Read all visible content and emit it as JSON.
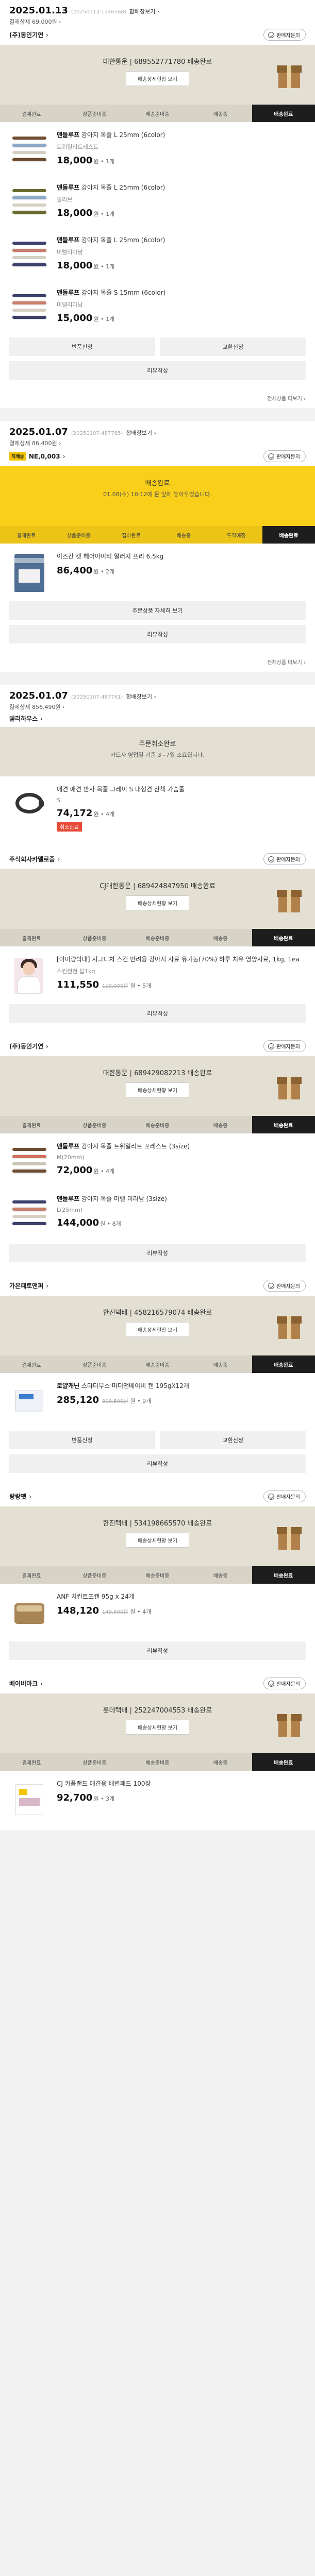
{
  "orders": [
    {
      "date": "2025.01.13",
      "order_no": "(20250113-1146568)",
      "detail_link": "합배장보기",
      "total": "결제상세 69,000원",
      "sub_orders": [
        {
          "seller": "(주)동인기연",
          "seller_badge": "",
          "inquiry_btn": "판매자문의",
          "status_title": "대한통운 | 689552771780 배송완료",
          "status_sub": "",
          "status_btn": "배송상세현황 보기",
          "box_icon": true,
          "steps": [
            "결제완료",
            "상품준비중",
            "배송준비중",
            "배송중",
            "배송완료"
          ],
          "active_step": 4,
          "items": [
            {
              "brand": "맨들루프",
              "title": "맨들루프 강아지 목줄 L 25mm (6color)",
              "option": "트위일리트레스트",
              "price": "18,000",
              "unit": "원 • 1개",
              "orig": "",
              "tag": "",
              "thumb": "collar1"
            },
            {
              "brand": "맨들루프",
              "title": "맨들루프 강아지 목줄 L 25mm (6color)",
              "option": "올리브",
              "price": "18,000",
              "unit": "원 • 1개",
              "orig": "",
              "tag": "",
              "thumb": "collar2"
            },
            {
              "brand": "맨들루프",
              "title": "맨들루프 강아지 목줄 L 25mm (6color)",
              "option": "미렐리아남",
              "price": "18,000",
              "unit": "원 • 1개",
              "orig": "",
              "tag": "",
              "thumb": "collar3"
            },
            {
              "brand": "맨들루프",
              "title": "맨들루프 강아지 목줄 S 15mm (6color)",
              "option": "미렐리아남",
              "price": "15,000",
              "unit": "원 • 1개",
              "orig": "",
              "tag": "",
              "thumb": "collar4"
            }
          ],
          "buttons_pair": [
            "반품신청",
            "교환신청"
          ],
          "button_full": "리뷰작성"
        }
      ],
      "more_link": "전체상품 더보기"
    },
    {
      "date": "2025.01.07",
      "order_no": "(20250107-487765)",
      "detail_link": "합배장보기",
      "total": "결제상세 86,400원",
      "sub_orders": [
        {
          "seller": "NE,0,003",
          "seller_badge": "직배송",
          "inquiry_btn": "판매자문의",
          "status_title": "배송완료",
          "status_sub": "01.08(수) 10:12에 문 앞에 놓아두었습니다.",
          "status_btn": "",
          "box_icon": false,
          "yellow": true,
          "steps": [
            "결제완료",
            "상품준비중",
            "집하완료",
            "배송중",
            "도착예정",
            "배송완료"
          ],
          "active_step": 5,
          "items": [
            {
              "brand": "",
              "title": "이즈칸 캣 헤어아이티 얼러지 프리 6.5kg",
              "option": "",
              "price": "86,400",
              "unit": "원 • 2개",
              "orig": "",
              "tag": "",
              "thumb": "bag"
            }
          ],
          "buttons_pair": [],
          "button_full": "주문상품 자세히 보기",
          "button_full2": "리뷰작성"
        }
      ],
      "more_link": "전체상품 더보기"
    },
    {
      "date": "2025.01.07",
      "order_no": "(20250107-487761)",
      "detail_link": "합배장보기",
      "total": "결제상세 856,490원",
      "sub_orders": [
        {
          "seller": "쉘리하우스",
          "seller_badge": "",
          "inquiry_btn": "",
          "status_title": "주문취소완료",
          "status_sub": "카드사 영업일 기준 3~7일 소요됩니다.",
          "status_btn": "",
          "box_icon": false,
          "steps": [],
          "active_step": -1,
          "items": [
            {
              "brand": "",
              "title": "애견 애견 반사 목줄 그레이 S 대형견 산책 가슴줄",
              "option": "S",
              "price": "74,172",
              "unit": "원 • 4개",
              "orig": "",
              "tag": "취소완료",
              "thumb": "band"
            }
          ],
          "buttons_pair": [],
          "button_full": ""
        },
        {
          "seller": "주식회사카멜로줌",
          "seller_badge": "",
          "inquiry_btn": "판매자문의",
          "status_title": "CJ대한통운 | 689424847950 배송완료",
          "status_sub": "",
          "status_btn": "배송상세현황 보기",
          "box_icon": true,
          "steps": [
            "결제완료",
            "상품준비중",
            "배송준비중",
            "배송중",
            "배송완료"
          ],
          "active_step": 4,
          "items": [
            {
              "brand": "",
              "title": "[이미량박대] 시그니처 스킨 반려용 강아지 사료 유기농(70%) 하루 치유 영양사료, 1kg, 1ea",
              "option": "스킨전천 탑1kg",
              "price": "111,550",
              "unit": "원 • 5개",
              "orig": "119,000원",
              "tag": "",
              "thumb": "person"
            }
          ],
          "buttons_pair": [],
          "button_full": "리뷰작성"
        },
        {
          "seller": "(주)동인기연",
          "seller_badge": "",
          "inquiry_btn": "판매자문의",
          "status_title": "대한통운 | 689429082213 배송완료",
          "status_sub": "",
          "status_btn": "배송상세현황 보기",
          "box_icon": true,
          "steps": [
            "결제완료",
            "상품준비중",
            "배송준비중",
            "배송중",
            "배송완료"
          ],
          "active_step": 4,
          "items": [
            {
              "brand": "맨들루프",
              "title": "맨들루프 강아지 목줄 트위일리트 포레스트 (3size)",
              "option": "M(20mm)",
              "price": "72,000",
              "unit": "원 • 4개",
              "orig": "",
              "tag": "",
              "thumb": "collar5"
            },
            {
              "brand": "맨들루프",
              "title": "맨들루프 강아지 목줄 미렐 미라남 (3size)",
              "option": "L(25mm)",
              "price": "144,000",
              "unit": "원 • 8개",
              "orig": "",
              "tag": "",
              "thumb": "collar6"
            }
          ],
          "buttons_pair": [],
          "button_full": "리뷰작성"
        },
        {
          "seller": "가온패토앤퍼",
          "seller_badge": "",
          "inquiry_btn": "판매자문의",
          "status_title": "한진택배 | 458216579074 배송완료",
          "status_sub": "",
          "status_btn": "배송상세현황 보기",
          "box_icon": true,
          "steps": [
            "결제완료",
            "상품준비중",
            "배송준비중",
            "배송중",
            "배송완료"
          ],
          "active_step": 4,
          "items": [
            {
              "brand": "로얄캐닌",
              "title": "로얄캐닌 스타터무스 마더앤베이비 캔 195gX12개",
              "option": "",
              "price": "285,120",
              "unit": "원 • 9개",
              "orig": "310,500원",
              "tag": "",
              "thumb": "cube"
            }
          ],
          "buttons_pair": [
            "반품신청",
            "교환신청"
          ],
          "button_full": "리뷰작성"
        },
        {
          "seller": "랑랑펫",
          "seller_badge": "",
          "inquiry_btn": "판매자문의",
          "status_title": "한진택배 | 534198665570 배송완료",
          "status_sub": "",
          "status_btn": "배송상세현황 보기",
          "box_icon": true,
          "steps": [
            "결제완료",
            "상품준비중",
            "배송준비중",
            "배송중",
            "배송완료"
          ],
          "active_step": 4,
          "items": [
            {
              "brand": "",
              "title": "ANF 치킨트프캔 95g x 24개",
              "option": "",
              "price": "148,120",
              "unit": "원 • 4개",
              "orig": "149,600원",
              "tag": "",
              "thumb": "can"
            }
          ],
          "buttons_pair": [],
          "button_full": "리뷰작성"
        },
        {
          "seller": "베이비마크",
          "seller_badge": "",
          "inquiry_btn": "판매자문의",
          "status_title": "롯데택배 | 252247004553 배송완료",
          "status_sub": "",
          "status_btn": "배송상세현황 보기",
          "box_icon": true,
          "steps": [
            "결제완료",
            "상품준비중",
            "배송준비중",
            "배송중",
            "배송완료"
          ],
          "active_step": 4,
          "items": [
            {
              "brand": "",
              "title": "CJ 카플랜드 애견용 배변패드 100장",
              "option": "",
              "price": "92,700",
              "unit": "원 • 3개",
              "orig": "",
              "tag": "",
              "thumb": "pouch"
            }
          ],
          "buttons_pair": [],
          "button_full": ""
        }
      ],
      "more_link": ""
    }
  ],
  "colors": {
    "status_beige": "#e3dfd2",
    "status_yellow": "#f9cf1a",
    "active_step": "#1d1d1d",
    "sale_tag": "#e84b38"
  },
  "collar_colors": {
    "collar1": [
      "#6e4a2e",
      "#8aa8c8",
      "#d6d0c2"
    ],
    "collar2": [
      "#6b6a2f",
      "#8aa8c8",
      "#d6d0c2"
    ],
    "collar3": [
      "#3a3f6b",
      "#c77e6a",
      "#d6d0c2"
    ],
    "collar4": [
      "#3a3f6b",
      "#c77e6a",
      "#d6d0c2"
    ],
    "collar5": [
      "#6e4a2e",
      "#d27060",
      "#c9c3b4"
    ],
    "collar6": [
      "#3a3f6b",
      "#c77e6a",
      "#d6d0c2"
    ]
  }
}
